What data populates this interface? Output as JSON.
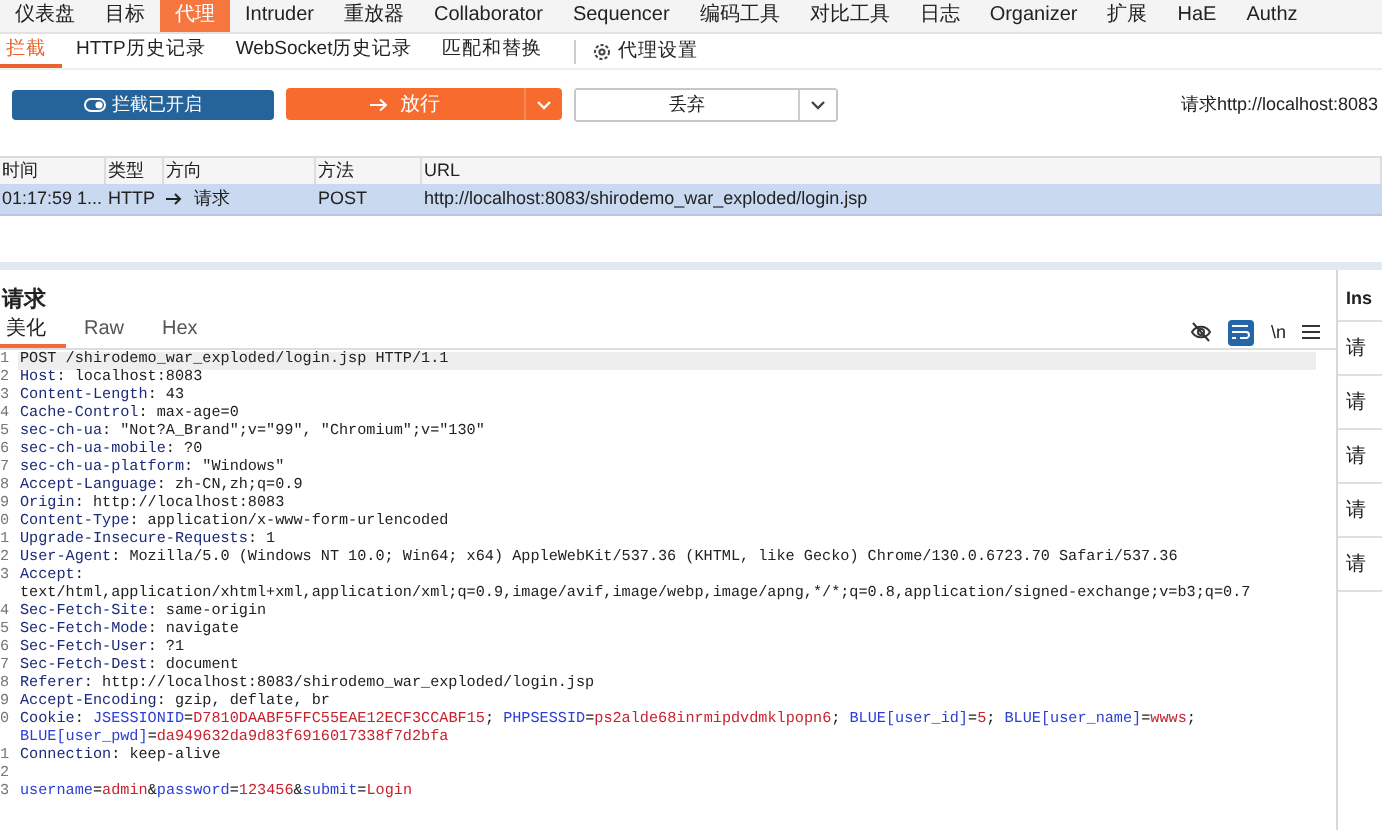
{
  "main_tabs": [
    {
      "label": "仪表盘",
      "selected": false
    },
    {
      "label": "目标",
      "selected": false
    },
    {
      "label": "代理",
      "selected": true
    },
    {
      "label": "Intruder",
      "selected": false
    },
    {
      "label": "重放器",
      "selected": false
    },
    {
      "label": "Collaborator",
      "selected": false
    },
    {
      "label": "Sequencer",
      "selected": false
    },
    {
      "label": "编码工具",
      "selected": false
    },
    {
      "label": "对比工具",
      "selected": false
    },
    {
      "label": "日志",
      "selected": false
    },
    {
      "label": "Organizer",
      "selected": false
    },
    {
      "label": "扩展",
      "selected": false
    },
    {
      "label": "HaE",
      "selected": false
    },
    {
      "label": "Authz",
      "selected": false
    }
  ],
  "sub_tabs": [
    {
      "label": "拦截",
      "selected": true
    },
    {
      "label": "HTTP历史记录",
      "selected": false
    },
    {
      "label": "WebSocket历史记录",
      "selected": false
    },
    {
      "label": "匹配和替换",
      "selected": false
    }
  ],
  "settings_tab": {
    "label": "代理设置"
  },
  "actions": {
    "intercept": {
      "label": "拦截已开启",
      "on": true
    },
    "forward": {
      "label": "放行"
    },
    "drop": {
      "label": "丢弃"
    },
    "request_info": "请求http://localhost:8083"
  },
  "table": {
    "columns": [
      "时间",
      "类型",
      "方向",
      "方法",
      "URL"
    ],
    "rows": [
      {
        "selected": true,
        "cells": [
          "01:17:59 1...",
          "HTTP",
          "请求",
          "POST",
          "http://localhost:8083/shirodemo_war_exploded/login.jsp"
        ]
      }
    ]
  },
  "request": {
    "title": "请求",
    "tabs": [
      {
        "label": "美化",
        "selected": true
      },
      {
        "label": "Raw",
        "selected": false
      },
      {
        "label": "Hex",
        "selected": false
      }
    ],
    "wrap_on": true,
    "newline_label": "\\n",
    "lines": [
      {
        "num": "1",
        "highlighted": true,
        "segments": [
          {
            "kind": "plain",
            "text": "POST /shirodemo_war_exploded/login.jsp HTTP/1.1"
          }
        ]
      },
      {
        "num": "2",
        "segments": [
          {
            "kind": "key",
            "text": "Host"
          },
          {
            "kind": "plain",
            "text": ": localhost:8083"
          }
        ]
      },
      {
        "num": "3",
        "segments": [
          {
            "kind": "key",
            "text": "Content-Length"
          },
          {
            "kind": "plain",
            "text": ": 43"
          }
        ]
      },
      {
        "num": "4",
        "segments": [
          {
            "kind": "key",
            "text": "Cache-Control"
          },
          {
            "kind": "plain",
            "text": ": max-age=0"
          }
        ]
      },
      {
        "num": "5",
        "segments": [
          {
            "kind": "key",
            "text": "sec-ch-ua"
          },
          {
            "kind": "plain",
            "text": ": \"Not?A_Brand\";v=\"99\", \"Chromium\";v=\"130\""
          }
        ]
      },
      {
        "num": "6",
        "segments": [
          {
            "kind": "key",
            "text": "sec-ch-ua-mobile"
          },
          {
            "kind": "plain",
            "text": ": ?0"
          }
        ]
      },
      {
        "num": "7",
        "segments": [
          {
            "kind": "key",
            "text": "sec-ch-ua-platform"
          },
          {
            "kind": "plain",
            "text": ": \"Windows\""
          }
        ]
      },
      {
        "num": "8",
        "segments": [
          {
            "kind": "key",
            "text": "Accept-Language"
          },
          {
            "kind": "plain",
            "text": ": zh-CN,zh;q=0.9"
          }
        ]
      },
      {
        "num": "9",
        "segments": [
          {
            "kind": "key",
            "text": "Origin"
          },
          {
            "kind": "plain",
            "text": ": http://localhost:8083"
          }
        ]
      },
      {
        "num": "0",
        "segments": [
          {
            "kind": "key",
            "text": "Content-Type"
          },
          {
            "kind": "plain",
            "text": ": application/x-www-form-urlencoded"
          }
        ]
      },
      {
        "num": "1",
        "segments": [
          {
            "kind": "key",
            "text": "Upgrade-Insecure-Requests"
          },
          {
            "kind": "plain",
            "text": ": 1"
          }
        ]
      },
      {
        "num": "2",
        "segments": [
          {
            "kind": "key",
            "text": "User-Agent"
          },
          {
            "kind": "plain",
            "text": ": Mozilla/5.0 (Windows NT 10.0; Win64; x64) AppleWebKit/537.36 (KHTML, like Gecko) Chrome/130.0.6723.70 Safari/537.36"
          }
        ]
      },
      {
        "num": "3",
        "segments": [
          {
            "kind": "key",
            "text": "Accept"
          },
          {
            "kind": "plain",
            "text": ":"
          }
        ]
      },
      {
        "segments": [
          {
            "kind": "plain",
            "text": "text/html,application/xhtml+xml,application/xml;q=0.9,image/avif,image/webp,image/apng,*/*;q=0.8,application/signed-exchange;v=b3;q=0.7"
          }
        ]
      },
      {
        "num": "4",
        "segments": [
          {
            "kind": "key",
            "text": "Sec-Fetch-Site"
          },
          {
            "kind": "plain",
            "text": ": same-origin"
          }
        ]
      },
      {
        "num": "5",
        "segments": [
          {
            "kind": "key",
            "text": "Sec-Fetch-Mode"
          },
          {
            "kind": "plain",
            "text": ": navigate"
          }
        ]
      },
      {
        "num": "6",
        "segments": [
          {
            "kind": "key",
            "text": "Sec-Fetch-User"
          },
          {
            "kind": "plain",
            "text": ": ?1"
          }
        ]
      },
      {
        "num": "7",
        "segments": [
          {
            "kind": "key",
            "text": "Sec-Fetch-Dest"
          },
          {
            "kind": "plain",
            "text": ": document"
          }
        ]
      },
      {
        "num": "8",
        "segments": [
          {
            "kind": "key",
            "text": "Referer"
          },
          {
            "kind": "plain",
            "text": ": http://localhost:8083/shirodemo_war_exploded/login.jsp"
          }
        ]
      },
      {
        "num": "9",
        "segments": [
          {
            "kind": "key",
            "text": "Accept-Encoding"
          },
          {
            "kind": "plain",
            "text": ": gzip, deflate, br"
          }
        ]
      },
      {
        "num": "0",
        "segments": [
          {
            "kind": "key",
            "text": "Cookie"
          },
          {
            "kind": "plain",
            "text": ": "
          },
          {
            "kind": "param",
            "text": "JSESSIONID"
          },
          {
            "kind": "plain",
            "text": "="
          },
          {
            "kind": "value",
            "text": "D7810DAABF5FFC55EAE12ECF3CCABF15"
          },
          {
            "kind": "plain",
            "text": "; "
          },
          {
            "kind": "param",
            "text": "PHPSESSID"
          },
          {
            "kind": "plain",
            "text": "="
          },
          {
            "kind": "value",
            "text": "ps2alde68inrmipdvdmklpopn6"
          },
          {
            "kind": "plain",
            "text": "; "
          },
          {
            "kind": "param",
            "text": "BLUE[user_id]"
          },
          {
            "kind": "plain",
            "text": "="
          },
          {
            "kind": "value",
            "text": "5"
          },
          {
            "kind": "plain",
            "text": "; "
          },
          {
            "kind": "param",
            "text": "BLUE[user_name]"
          },
          {
            "kind": "plain",
            "text": "="
          },
          {
            "kind": "value",
            "text": "wwws"
          },
          {
            "kind": "plain",
            "text": ";"
          }
        ]
      },
      {
        "segments": [
          {
            "kind": "param",
            "text": "BLUE[user_pwd]"
          },
          {
            "kind": "plain",
            "text": "="
          },
          {
            "kind": "value",
            "text": "da949632da9d83f6916017338f7d2bfa"
          }
        ]
      },
      {
        "num": "1",
        "segments": [
          {
            "kind": "key",
            "text": "Connection"
          },
          {
            "kind": "plain",
            "text": ": keep-alive"
          }
        ]
      },
      {
        "num": "2"
      },
      {
        "num": "3",
        "segments": [
          {
            "kind": "param",
            "text": "username"
          },
          {
            "kind": "plain",
            "text": "="
          },
          {
            "kind": "value",
            "text": "admin"
          },
          {
            "kind": "plain",
            "text": "&"
          },
          {
            "kind": "param",
            "text": "password"
          },
          {
            "kind": "plain",
            "text": "="
          },
          {
            "kind": "value",
            "text": "123456"
          },
          {
            "kind": "plain",
            "text": "&"
          },
          {
            "kind": "param",
            "text": "submit"
          },
          {
            "kind": "plain",
            "text": "="
          },
          {
            "kind": "value",
            "text": "Login"
          }
        ]
      }
    ]
  },
  "inspector": {
    "title": "Ins",
    "items": [
      "请",
      "请",
      "请",
      "请",
      "请"
    ]
  }
}
